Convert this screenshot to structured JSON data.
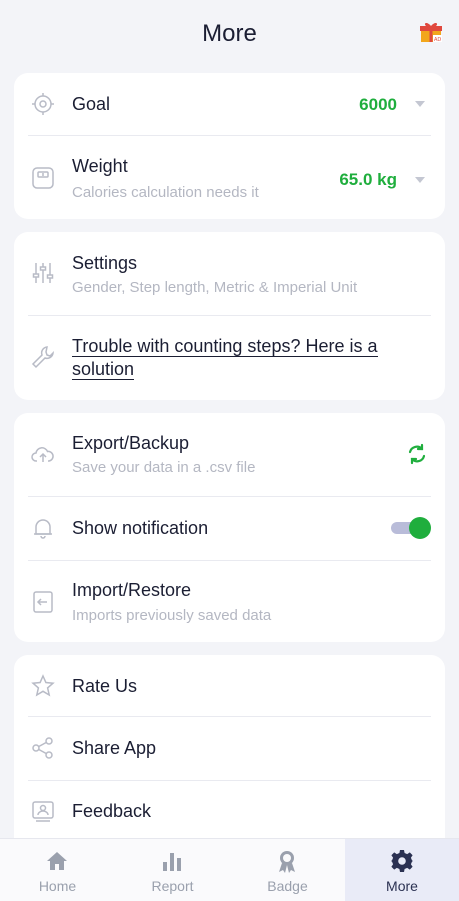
{
  "header": {
    "title": "More",
    "gift_icon": "gift-ad-icon"
  },
  "cards": {
    "goal": {
      "label": "Goal",
      "value": "6000",
      "icon": "target-icon"
    },
    "weight": {
      "label": "Weight",
      "subtitle": "Calories calculation needs it",
      "value": "65.0 kg",
      "icon": "scale-icon"
    },
    "settings": {
      "label": "Settings",
      "subtitle": "Gender, Step length, Metric & Imperial Unit",
      "icon": "sliders-icon"
    },
    "trouble": {
      "text": "Trouble with counting steps? Here is a solution",
      "icon": "wrench-icon"
    },
    "export": {
      "label": "Export/Backup",
      "subtitle": "Save your data in a .csv file",
      "icon": "cloud-upload-icon",
      "action_icon": "sync-icon"
    },
    "notification": {
      "label": "Show notification",
      "enabled": true,
      "icon": "bell-icon"
    },
    "import": {
      "label": "Import/Restore",
      "subtitle": "Imports previously saved data",
      "icon": "import-icon"
    },
    "rate": {
      "label": "Rate Us",
      "icon": "star-icon"
    },
    "share": {
      "label": "Share App",
      "icon": "share-icon"
    },
    "feedback": {
      "label": "Feedback",
      "icon": "feedback-icon"
    }
  },
  "tabs": [
    {
      "label": "Home",
      "icon": "home-icon",
      "active": false
    },
    {
      "label": "Report",
      "icon": "bar-chart-icon",
      "active": false
    },
    {
      "label": "Badge",
      "icon": "badge-icon",
      "active": false
    },
    {
      "label": "More",
      "icon": "gear-icon",
      "active": true
    }
  ],
  "colors": {
    "accent": "#1fae3d",
    "text": "#1b1e33",
    "muted": "#b4b7c2",
    "background": "#f3f4f8"
  }
}
